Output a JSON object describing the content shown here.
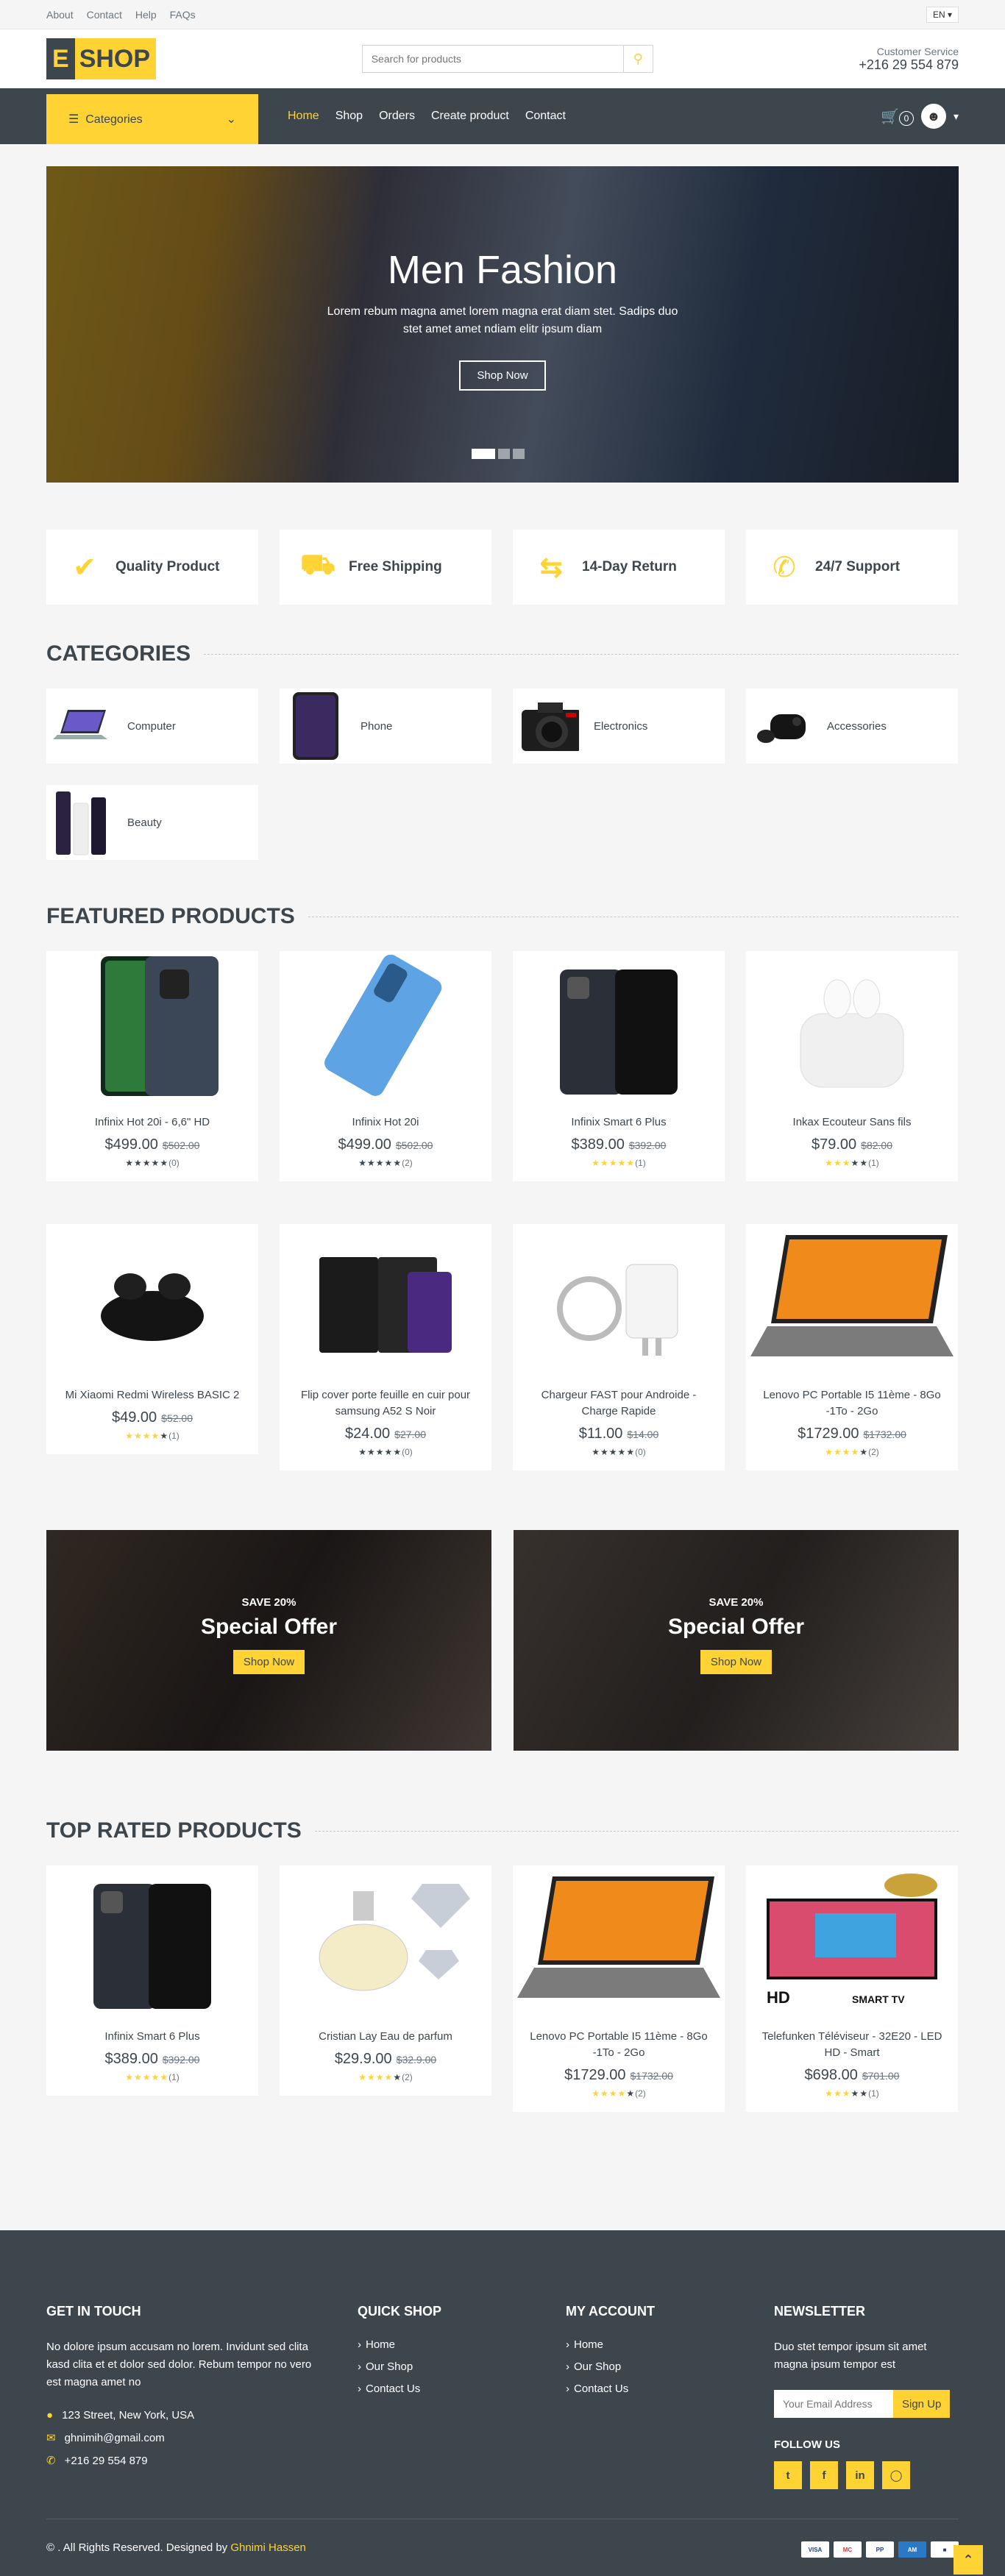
{
  "topbar": {
    "links": [
      "About",
      "Contact",
      "Help",
      "FAQs"
    ],
    "lang": "EN"
  },
  "header": {
    "logo_left": "E",
    "logo_right": "SHOP",
    "search_placeholder": "Search for products",
    "service_label": "Customer Service",
    "service_phone": "+216 29 554 879"
  },
  "nav": {
    "categories": "Categories",
    "menu": [
      "Home",
      "Shop",
      "Orders",
      "Create product",
      "Contact"
    ],
    "cart_count": "0"
  },
  "hero": {
    "title": "Men Fashion",
    "text": "Lorem rebum magna amet lorem magna erat diam stet. Sadips duo stet amet amet ndiam elitr ipsum diam",
    "button": "Shop Now"
  },
  "features": [
    "Quality Product",
    "Free Shipping",
    "14-Day Return",
    "24/7 Support"
  ],
  "sections": {
    "categories": "Categories",
    "featured": "Featured Products",
    "top_rated": "Top Rated Products"
  },
  "categories": [
    "Computer",
    "Phone",
    "Electronics",
    "Accessories",
    "Beauty"
  ],
  "featured": [
    {
      "name": "Infinix Hot 20i - 6,6\" HD",
      "price": "$499.00",
      "old": "$502.00",
      "rating": 0,
      "count": "(0)"
    },
    {
      "name": "Infinix Hot 20i",
      "price": "$499.00",
      "old": "$502.00",
      "rating": 0,
      "count": "(2)"
    },
    {
      "name": "Infinix Smart 6 Plus",
      "price": "$389.00",
      "old": "$392.00",
      "rating": 5,
      "count": "(1)"
    },
    {
      "name": "Inkax Ecouteur Sans fils",
      "price": "$79.00",
      "old": "$82.00",
      "rating": 3,
      "count": "(1)"
    },
    {
      "name": "Mi Xiaomi Redmi Wireless BASIC 2",
      "price": "$49.00",
      "old": "$52.00",
      "rating": 4,
      "count": "(1)"
    },
    {
      "name": "Flip cover porte feuille en cuir pour samsung A52 S Noir",
      "price": "$24.00",
      "old": "$27.00",
      "rating": 0,
      "count": "(0)"
    },
    {
      "name": "Chargeur FAST pour Androide - Charge Rapide",
      "price": "$11.00",
      "old": "$14.00",
      "rating": 0,
      "count": "(0)"
    },
    {
      "name": "Lenovo PC Portable I5 11ème - 8Go -1To - 2Go",
      "price": "$1729.00",
      "old": "$1732.00",
      "rating": 4,
      "count": "(2)"
    }
  ],
  "offers": [
    {
      "save": "SAVE 20%",
      "title": "Special Offer",
      "button": "Shop Now"
    },
    {
      "save": "SAVE 20%",
      "title": "Special Offer",
      "button": "Shop Now"
    }
  ],
  "top_rated": [
    {
      "name": "Infinix Smart 6 Plus",
      "price": "$389.00",
      "old": "$392.00",
      "rating": 5,
      "count": "(1)"
    },
    {
      "name": "Cristian Lay Eau de parfum",
      "price": "$29.9.00",
      "old": "$32.9.00",
      "rating": 4,
      "count": "(2)"
    },
    {
      "name": "Lenovo PC Portable I5 11ème - 8Go -1To - 2Go",
      "price": "$1729.00",
      "old": "$1732.00",
      "rating": 4,
      "count": "(2)"
    },
    {
      "name": "Telefunken Téléviseur - 32E20 - LED HD - Smart",
      "price": "$698.00",
      "old": "$701.00",
      "rating": 3,
      "count": "(1)"
    }
  ],
  "footer": {
    "touch_title": "Get In Touch",
    "touch_text": "No dolore ipsum accusam no lorem. Invidunt sed clita kasd clita et et dolor sed dolor. Rebum tempor no vero est magna amet no",
    "address": "123 Street, New York, USA",
    "email": "ghnimih@gmail.com",
    "phone": "+216 29 554 879",
    "quick_title": "Quick Shop",
    "quick_links": [
      "Home",
      "Our Shop",
      "Contact Us"
    ],
    "account_title": "My Account",
    "account_links": [
      "Home",
      "Our Shop",
      "Contact Us"
    ],
    "newsletter_title": "Newsletter",
    "newsletter_text": "Duo stet tempor ipsum sit amet magna ipsum tempor est",
    "email_placeholder": "Your Email Address",
    "signup": "Sign Up",
    "follow": "Follow Us",
    "copyright": "© . All Rights Reserved. Designed by",
    "designer": "Ghnimi Hassen"
  },
  "colors": {
    "accent": "#ffd333",
    "dark": "#3d464d",
    "bg": "#f5f5f5"
  }
}
